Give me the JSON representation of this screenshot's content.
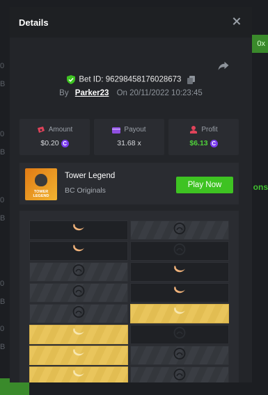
{
  "background": {
    "left_strips": [
      "0 B",
      "0 B",
      "0 B",
      "0 B",
      "0 B"
    ],
    "right_badge": "0x",
    "right_text": "ons"
  },
  "modal": {
    "title": "Details",
    "bet_id_label": "Bet ID:",
    "bet_id": "96298458176028673",
    "by_label": "By",
    "username": "Parker23",
    "on_label": "On",
    "datetime": "20/11/2022 10:23:45"
  },
  "stats": [
    {
      "label": "Amount",
      "value": "$0.20",
      "icon": "money-icon",
      "icon_color": "#e0435a",
      "coin": true
    },
    {
      "label": "Payout",
      "value": "31.68 x",
      "icon": "wallet-icon",
      "icon_color": "#8f4fe0",
      "coin": false
    },
    {
      "label": "Profit",
      "value": "$6.13",
      "icon": "profit-icon",
      "icon_color": "#e0435a",
      "coin": true
    }
  ],
  "game": {
    "name": "Tower Legend",
    "provider": "BC Originals",
    "play_label": "Play Now",
    "thumb_text_1": "TOWER",
    "thumb_text_2": "LEGEND"
  },
  "coin_symbol": "C",
  "board": {
    "rows": [
      [
        "dark-banana",
        "stripe-skull"
      ],
      [
        "dark-banana",
        "dark-skull"
      ],
      [
        "stripe-skull",
        "dark-banana"
      ],
      [
        "stripe-skull",
        "dark-banana"
      ],
      [
        "stripe-skull",
        "gold-banana"
      ],
      [
        "gold-banana",
        "dark-skull"
      ],
      [
        "gold-banana",
        "stripe-skull"
      ],
      [
        "gold-banana",
        "stripe-skull"
      ]
    ]
  },
  "colors": {
    "accent_green": "#3ec322",
    "profit_green": "#4fd13a",
    "gold": "#e9c55c",
    "coin_purple": "#7b3df0"
  }
}
